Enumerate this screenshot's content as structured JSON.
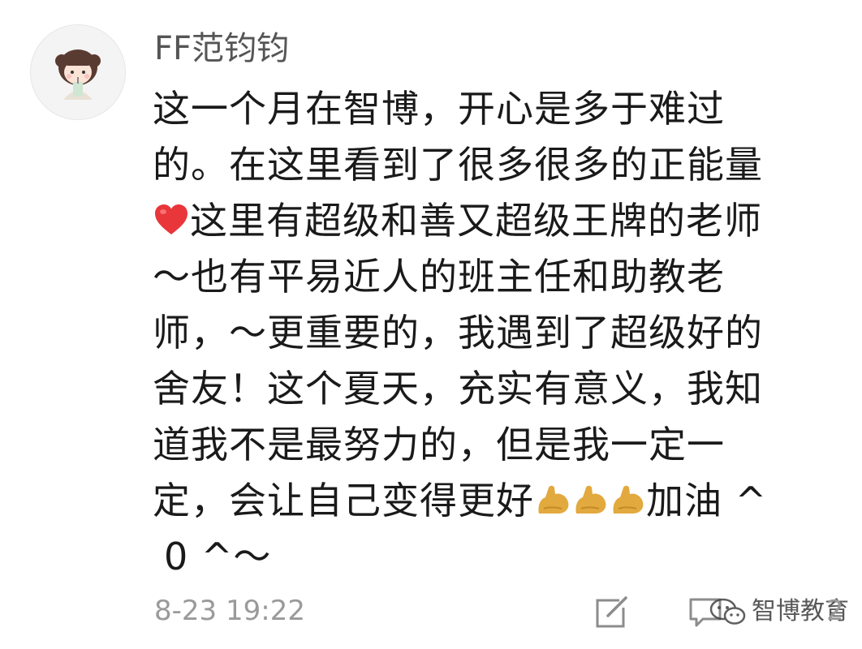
{
  "user": {
    "name": "FF范钧钧",
    "avatar_icon": "cartoon-girl-avatar"
  },
  "comment": {
    "lines": [
      "这一个月在智博，开心是多于难过",
      "的。在这里看到了很多很多的正能量",
      "这里有超级和善又超级王牌的老师",
      "～也有平易近人的班主任和助教老",
      "师，～更重要的，我遇到了超级好的",
      "舍友！这个夏天，充实有意义，我知",
      "道我不是最努力的，但是我一定一",
      "定，会让自己变得更好",
      "0 ^～"
    ],
    "line9_suffix": "加油 ^",
    "emoji": {
      "heart": "red-heart-emoji",
      "flexed_biceps": "flexed-biceps-emoji"
    }
  },
  "footer": {
    "time": "8-23 19:22",
    "edit_icon": "edit-icon",
    "comment_icon": "comment-icon",
    "comment_count": "2"
  },
  "watermark": {
    "text": "智博教育",
    "logo": "wechat-logo"
  },
  "colors": {
    "text": "#1a1a1a",
    "muted": "#9a9a9a",
    "username": "#555555",
    "heart": "#e8363a",
    "biceps": "#e2a93f"
  }
}
